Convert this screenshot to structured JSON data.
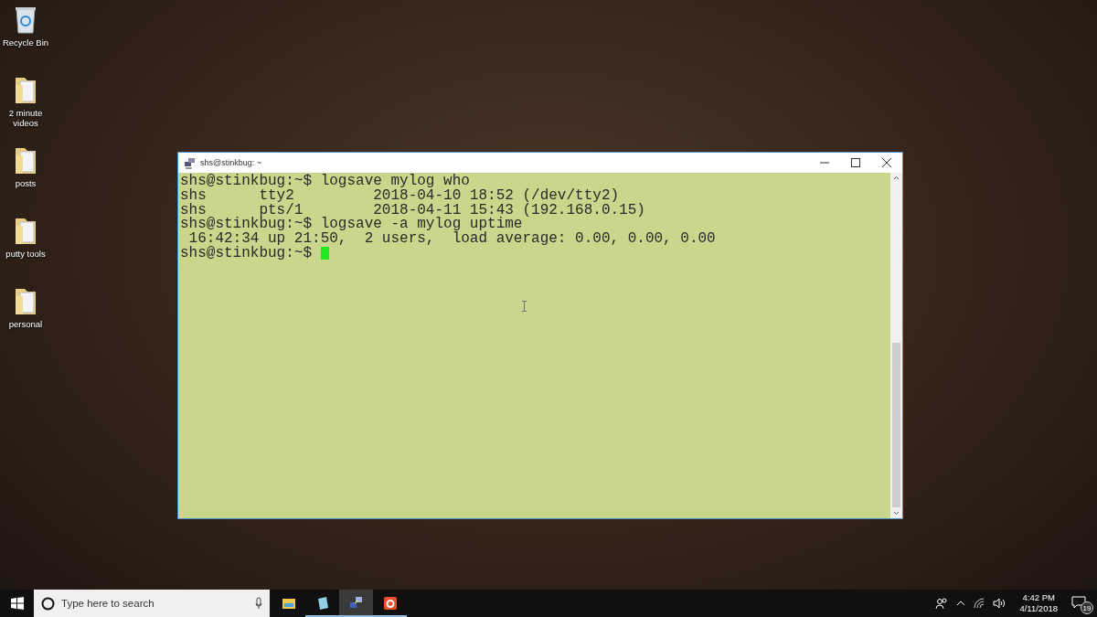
{
  "desktop_icons": [
    {
      "kind": "bin",
      "label": "Recycle Bin"
    },
    {
      "kind": "folder",
      "label": "2 minute videos"
    },
    {
      "kind": "folder",
      "label": "posts"
    },
    {
      "kind": "folder",
      "label": "putty tools"
    },
    {
      "kind": "folder",
      "label": "personal"
    }
  ],
  "window": {
    "title": "shs@stinkbug: ~"
  },
  "terminal": {
    "lines": [
      "shs@stinkbug:~$ logsave mylog who",
      "shs      tty2         2018-04-10 18:52 (/dev/tty2)",
      "shs      pts/1        2018-04-11 15:43 (192.168.0.15)",
      "shs@stinkbug:~$ logsave -a mylog uptime",
      " 16:42:34 up 21:50,  2 users,  load average: 0.00, 0.00, 0.00",
      "shs@stinkbug:~$ "
    ]
  },
  "taskbar": {
    "search": {
      "placeholder": "Type here to search"
    },
    "apps": [
      {
        "kind": "explorer",
        "running": false,
        "selected": false
      },
      {
        "kind": "notes",
        "running": true,
        "selected": false
      },
      {
        "kind": "putty",
        "running": true,
        "selected": true
      },
      {
        "kind": "camera",
        "running": true,
        "selected": false
      }
    ],
    "time": "4:42 PM",
    "date": "4/11/2018",
    "notifications": "19"
  }
}
